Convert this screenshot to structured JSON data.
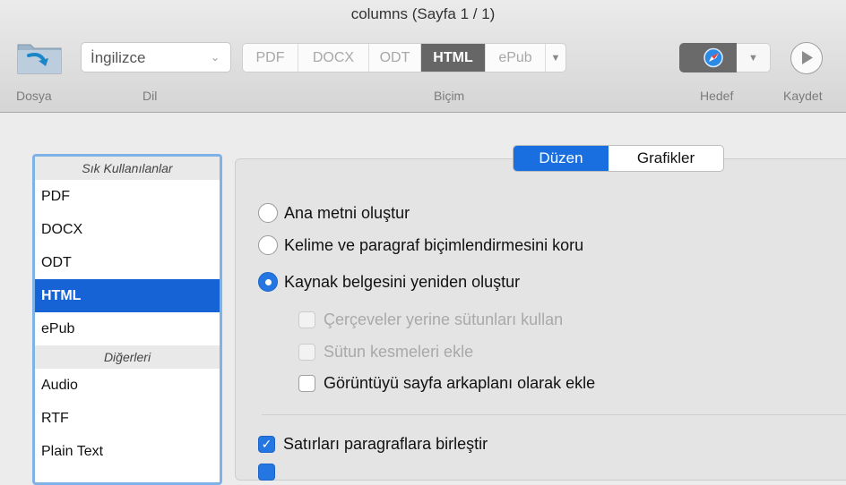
{
  "window": {
    "title": "columns (Sayfa 1 / 1)"
  },
  "toolbar": {
    "file_label": "Dosya",
    "language": {
      "value": "İngilizce",
      "label": "Dil"
    },
    "format": {
      "label": "Biçim",
      "options": [
        "PDF",
        "DOCX",
        "ODT",
        "HTML",
        "ePub"
      ],
      "selected": "HTML"
    },
    "target_label": "Hedef",
    "save_label": "Kaydet",
    "icons": {
      "file": "folder-arrow-icon",
      "target": "safari-compass-icon",
      "save": "play-icon",
      "dropdown": "chevron-down-icon"
    }
  },
  "sidebar": {
    "favorites_header": "Sık Kullanılanlar",
    "favorites": [
      "PDF",
      "DOCX",
      "ODT",
      "HTML",
      "ePub"
    ],
    "selected": "HTML",
    "others_header": "Diğerleri",
    "others": [
      "Audio",
      "RTF",
      "Plain Text"
    ]
  },
  "tabs": {
    "items": [
      "Düzen",
      "Grafikler"
    ],
    "active": "Düzen"
  },
  "options": {
    "radio_main_text": "Ana metni oluştur",
    "radio_keep_formatting": "Kelime ve paragraf biçimlendirmesini koru",
    "radio_recreate": "Kaynak belgesini yeniden oluştur",
    "radio_selected": "Kaynak belgesini yeniden oluştur",
    "check_columns": "Çerçeveler yerine sütunları kullan",
    "check_column_breaks": "Sütun kesmeleri ekle",
    "check_background": "Görüntüyü sayfa arkaplanı olarak ekle",
    "check_merge_lines": "Satırları paragraflara birleştir",
    "check_merge_lines_checked": true
  },
  "colors": {
    "accent": "#1a6fe0",
    "selection": "#1663d6",
    "sidebar_border": "#7fb2e6"
  }
}
